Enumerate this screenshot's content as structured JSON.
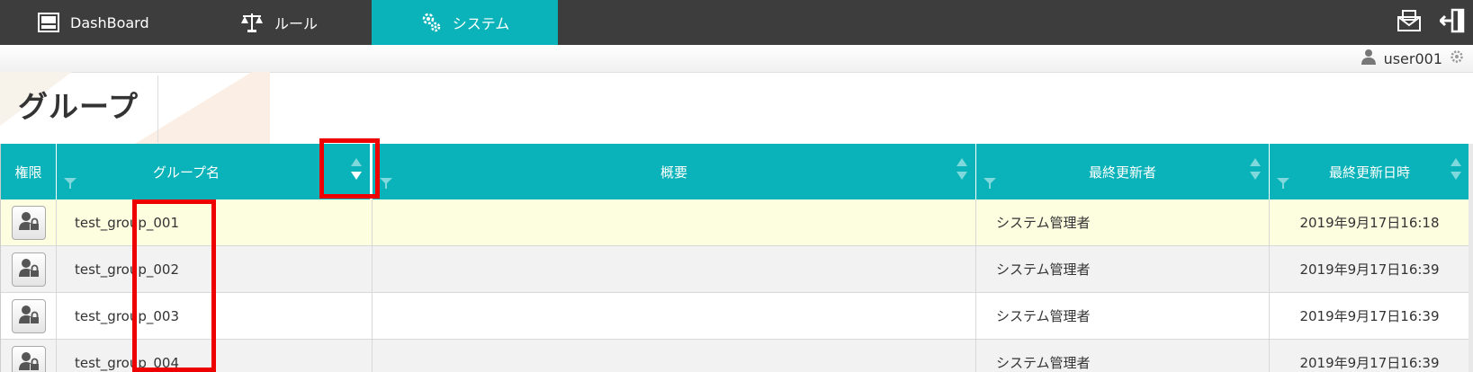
{
  "nav": {
    "tabs": [
      {
        "label": "DashBoard",
        "icon": "dashboard-icon"
      },
      {
        "label": "ルール",
        "icon": "scale-icon"
      },
      {
        "label": "システム",
        "icon": "gears-icon"
      }
    ],
    "active_tab": "システム",
    "right_icons": [
      "mail-icon",
      "logout-icon"
    ]
  },
  "user": {
    "name": "user001",
    "icons": [
      "user-icon",
      "gear-icon"
    ]
  },
  "page": {
    "title": "グループ"
  },
  "table": {
    "columns": [
      {
        "label": "権限"
      },
      {
        "label": "グループ名",
        "sort": "descending"
      },
      {
        "label": "概要"
      },
      {
        "label": "最終更新者"
      },
      {
        "label": "最終更新日時"
      }
    ],
    "rows": [
      {
        "group_name": "test_group_001",
        "summary": "",
        "updater": "システム管理者",
        "updated_at": "2019年9月17日16:18"
      },
      {
        "group_name": "test_group_002",
        "summary": "",
        "updater": "システム管理者",
        "updated_at": "2019年9月17日16:39"
      },
      {
        "group_name": "test_group_003",
        "summary": "",
        "updater": "システム管理者",
        "updated_at": "2019年9月17日16:39"
      },
      {
        "group_name": "test_group_004",
        "summary": "",
        "updater": "システム管理者",
        "updated_at": "2019年9月17日16:39"
      }
    ]
  },
  "colors": {
    "accent": "#0ab3b9",
    "topbar": "#3d3d3d",
    "selected_row": "#fdfde0",
    "alt_row": "#f2f2f2",
    "highlight": "#ee0000"
  }
}
